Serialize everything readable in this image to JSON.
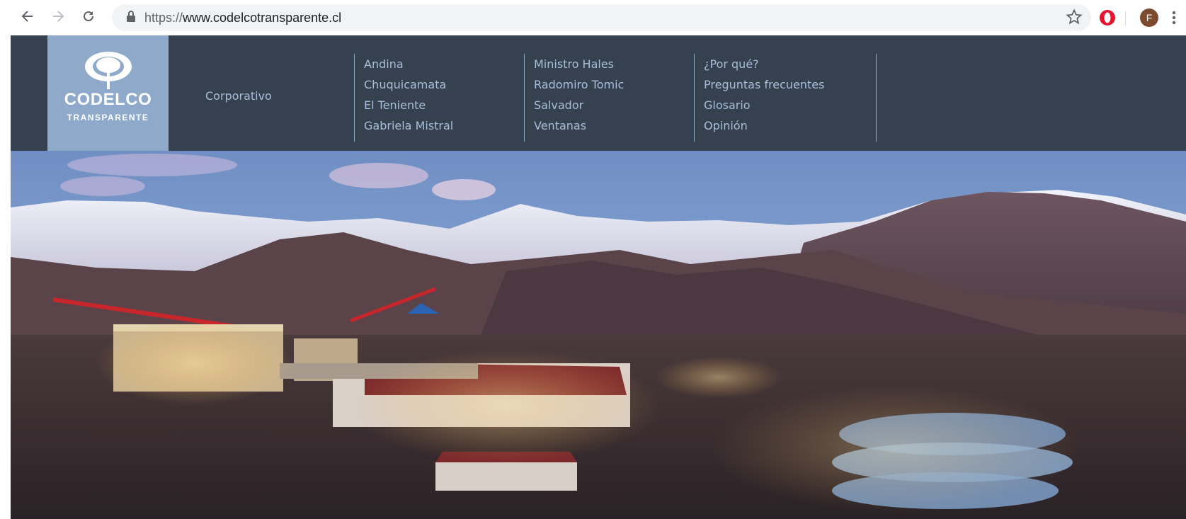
{
  "browser": {
    "url_scheme": "https://",
    "url_host": "www.codelcotransparente.cl",
    "profile_initial": "F",
    "icons": [
      "back-arrow-icon",
      "forward-arrow-icon",
      "reload-icon",
      "lock-icon",
      "star-icon",
      "opera-icon",
      "kebab-menu-icon"
    ]
  },
  "site": {
    "logo": {
      "name": "CODELCO",
      "sub": "TRANSPARENTE"
    },
    "nav": {
      "corporativo": "Corporativo",
      "col1": [
        "Andina",
        "Chuquicamata",
        "El Teniente",
        "Gabriela Mistral"
      ],
      "col2": [
        "Ministro Hales",
        "Radomiro Tomic",
        "Salvador",
        "Ventanas"
      ],
      "col3": [
        "¿Por qué?",
        "Preguntas frecuentes",
        "Glosario",
        "Opinión"
      ]
    },
    "colors": {
      "header_bg": "#35414f",
      "logo_bg": "#8fa9cb",
      "link": "#a9bfd9"
    }
  }
}
